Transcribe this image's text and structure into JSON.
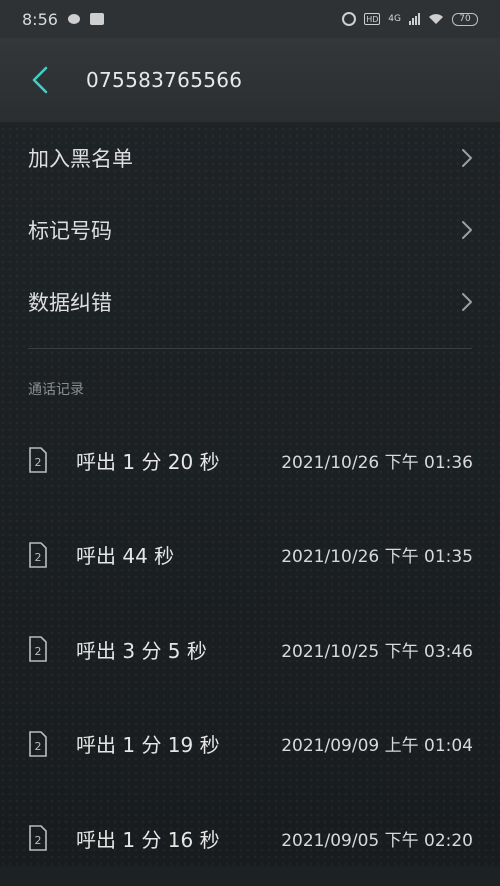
{
  "status_bar": {
    "time": "8:56",
    "network": "4G",
    "hd": "HD",
    "battery": "70"
  },
  "header": {
    "phone_number": "075583765566"
  },
  "menu": [
    {
      "label": "加入黑名单"
    },
    {
      "label": "标记号码"
    },
    {
      "label": "数据纠错"
    }
  ],
  "call_log": {
    "section_title": "通话记录",
    "sim_label": "2",
    "items": [
      {
        "type": "呼出 1 分 20 秒",
        "datetime": "2021/10/26 下午 01:36"
      },
      {
        "type": "呼出 44 秒",
        "datetime": "2021/10/26 下午 01:35"
      },
      {
        "type": "呼出 3 分 5 秒",
        "datetime": "2021/10/25 下午 03:46"
      },
      {
        "type": "呼出 1 分 19 秒",
        "datetime": "2021/09/09 上午 01:04"
      },
      {
        "type": "呼出 1 分 16 秒",
        "datetime": "2021/09/05 下午 02:20"
      }
    ]
  },
  "colors": {
    "accent": "#3fd0c8",
    "background": "#1c2124",
    "header": "#2f3234"
  }
}
